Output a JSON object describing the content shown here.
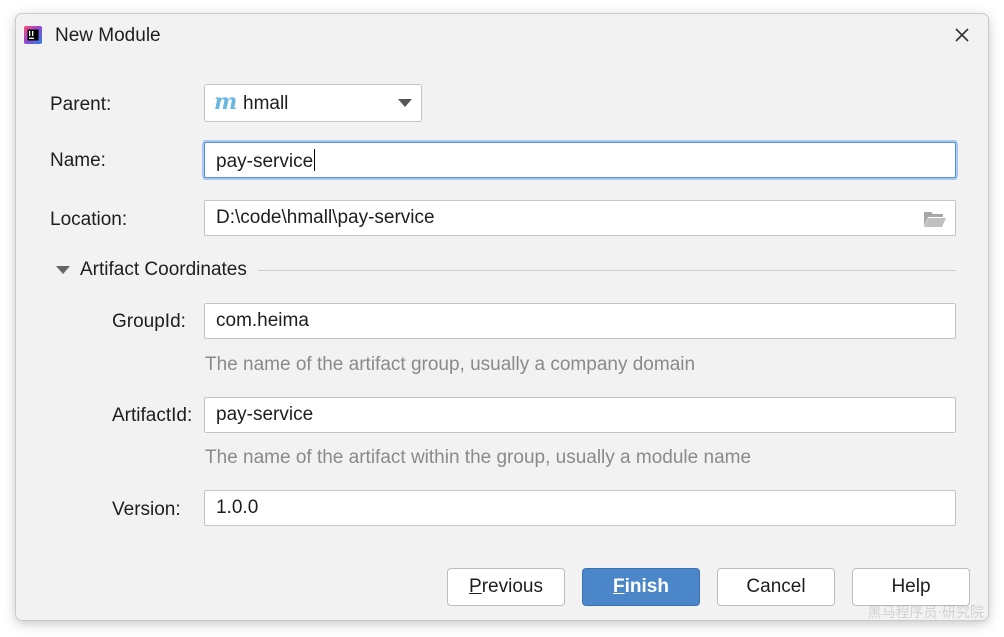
{
  "window": {
    "title": "New Module",
    "app_icon": "intellij-idea-icon",
    "close_icon": "close-icon"
  },
  "form": {
    "parent": {
      "label": "Parent:",
      "value": "hmall",
      "icon": "maven-icon"
    },
    "name": {
      "label": "Name:",
      "value": "pay-service"
    },
    "location": {
      "label": "Location:",
      "value": "D:\\code\\hmall\\pay-service",
      "icon": "folder-open-icon"
    }
  },
  "artifact": {
    "section_title": "Artifact Coordinates",
    "group_id": {
      "label": "GroupId:",
      "value": "com.heima",
      "hint": "The name of the artifact group, usually a company domain"
    },
    "artifact_id": {
      "label": "ArtifactId:",
      "value": "pay-service",
      "hint": "The name of the artifact within the group, usually a module name"
    },
    "version": {
      "label": "Version:",
      "value": "1.0.0"
    }
  },
  "buttons": {
    "previous": {
      "mnemonic": "P",
      "rest": "revious"
    },
    "finish": {
      "mnemonic": "F",
      "rest": "inish"
    },
    "cancel": "Cancel",
    "help": "Help"
  },
  "watermark": "黑马程序员·研究院",
  "colors": {
    "primary_button": "#4b87c8",
    "focus_ring": "#a9c8ef",
    "hint_text": "#8a8a8a",
    "maven_icon": "#6ab7e0"
  }
}
